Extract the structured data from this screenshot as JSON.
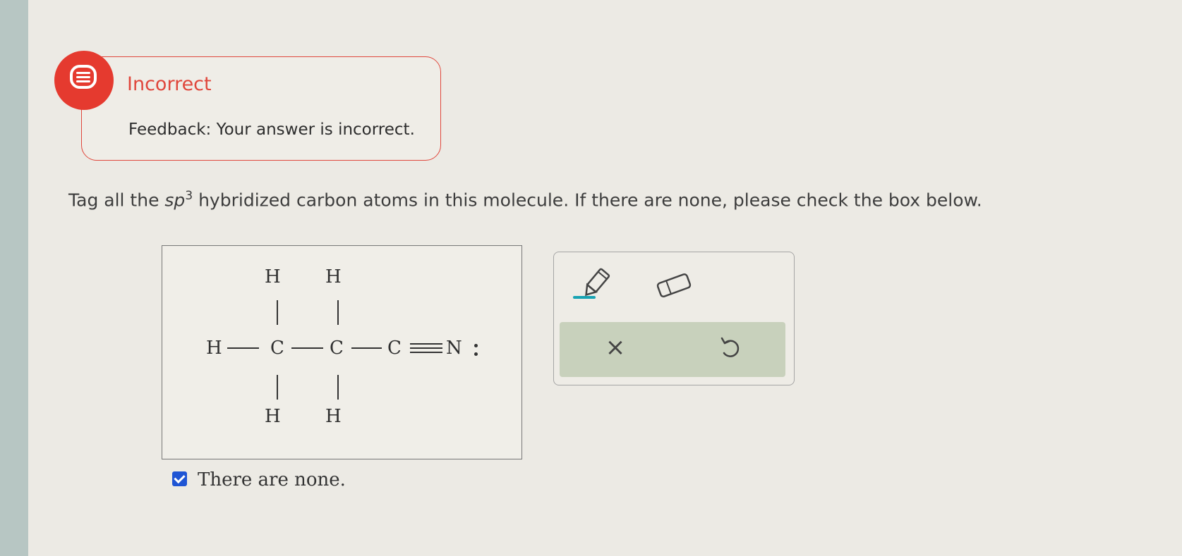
{
  "feedback": {
    "status": "Incorrect",
    "message": "Feedback: Your answer is incorrect."
  },
  "question": {
    "prefix": "Tag all the ",
    "term": "sp",
    "superscript": "3",
    "suffix": " hybridized carbon atoms in this molecule. If there are none, please check the box below."
  },
  "molecule": {
    "atoms": {
      "h_top_1": "H",
      "h_top_2": "H",
      "h_left": "H",
      "c1": "C",
      "c2": "C",
      "c3": "C",
      "n": "N",
      "h_bottom_1": "H",
      "h_bottom_2": "H"
    }
  },
  "none_checkbox": {
    "checked": true,
    "label": "There are none."
  },
  "tools": {
    "pencil_icon": "pencil-icon",
    "eraser_icon": "eraser-icon",
    "clear_symbol": "×",
    "undo_icon": "undo-icon"
  },
  "colors": {
    "incorrect_red": "#e0473c",
    "checkbox_blue": "#1f55d4",
    "action_bar_green": "#c8d1bc",
    "pencil_teal": "#17a3b3"
  }
}
